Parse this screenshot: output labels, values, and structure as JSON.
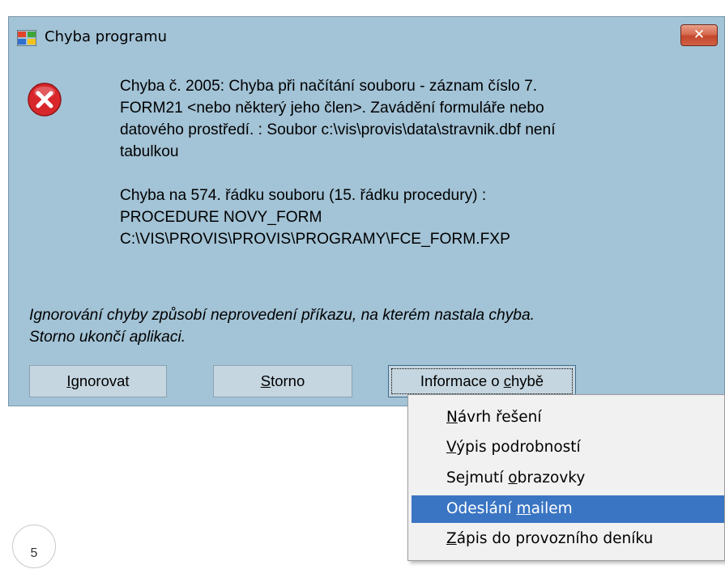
{
  "window": {
    "title": "Chyba programu",
    "close_label": "✕"
  },
  "message": {
    "line1": "Chyba č. 2005: Chyba při načítání souboru - záznam číslo 7.",
    "line2": "FORM21 <nebo některý jeho člen>. Zavádění formuláře nebo",
    "line3": "datového prostředí. : Soubor c:\\vis\\provis\\data\\stravnik.dbf není",
    "line4": "tabulkou",
    "line5": "Chyba na 574. řádku souboru (15. řádku procedury) :",
    "line6": "PROCEDURE NOVY_FORM",
    "line7": "C:\\VIS\\PROVIS\\PROVIS\\PROGRAMY\\FCE_FORM.FXP"
  },
  "note": {
    "line1": "Ignorování chyby způsobí neprovedení příkazu, na kterém nastala chyba.",
    "line2": "Storno ukončí aplikaci."
  },
  "buttons": {
    "ignore": {
      "mnemonic": "I",
      "rest": "gnorovat"
    },
    "storno": {
      "mnemonic": "S",
      "rest": "torno"
    },
    "info": {
      "before": "Informace o ",
      "mnemonic": "c",
      "after": "hybě"
    }
  },
  "menu": {
    "items": [
      {
        "before": "",
        "mnemonic": "N",
        "after": "ávrh řešení",
        "highlighted": false
      },
      {
        "before": "",
        "mnemonic": "V",
        "after": "ýpis podrobností",
        "highlighted": false
      },
      {
        "before": "Sejmutí ",
        "mnemonic": "o",
        "after": "brazovky",
        "highlighted": false
      },
      {
        "before": "Odeslání ",
        "mnemonic": "m",
        "after": "ailem",
        "highlighted": true
      },
      {
        "before": "",
        "mnemonic": "Z",
        "after": "ápis do provozního deníku",
        "highlighted": false
      }
    ]
  },
  "page_number": "5",
  "colors": {
    "dialog_bg": "#a3c3d6",
    "button_bg": "#c5d6e0",
    "menu_highlight": "#3a75c3",
    "close_red": "#c4472c",
    "error_red": "#d8272b"
  },
  "icons": {
    "app": "windows-flag-icon",
    "error": "error-circle-x-icon"
  }
}
